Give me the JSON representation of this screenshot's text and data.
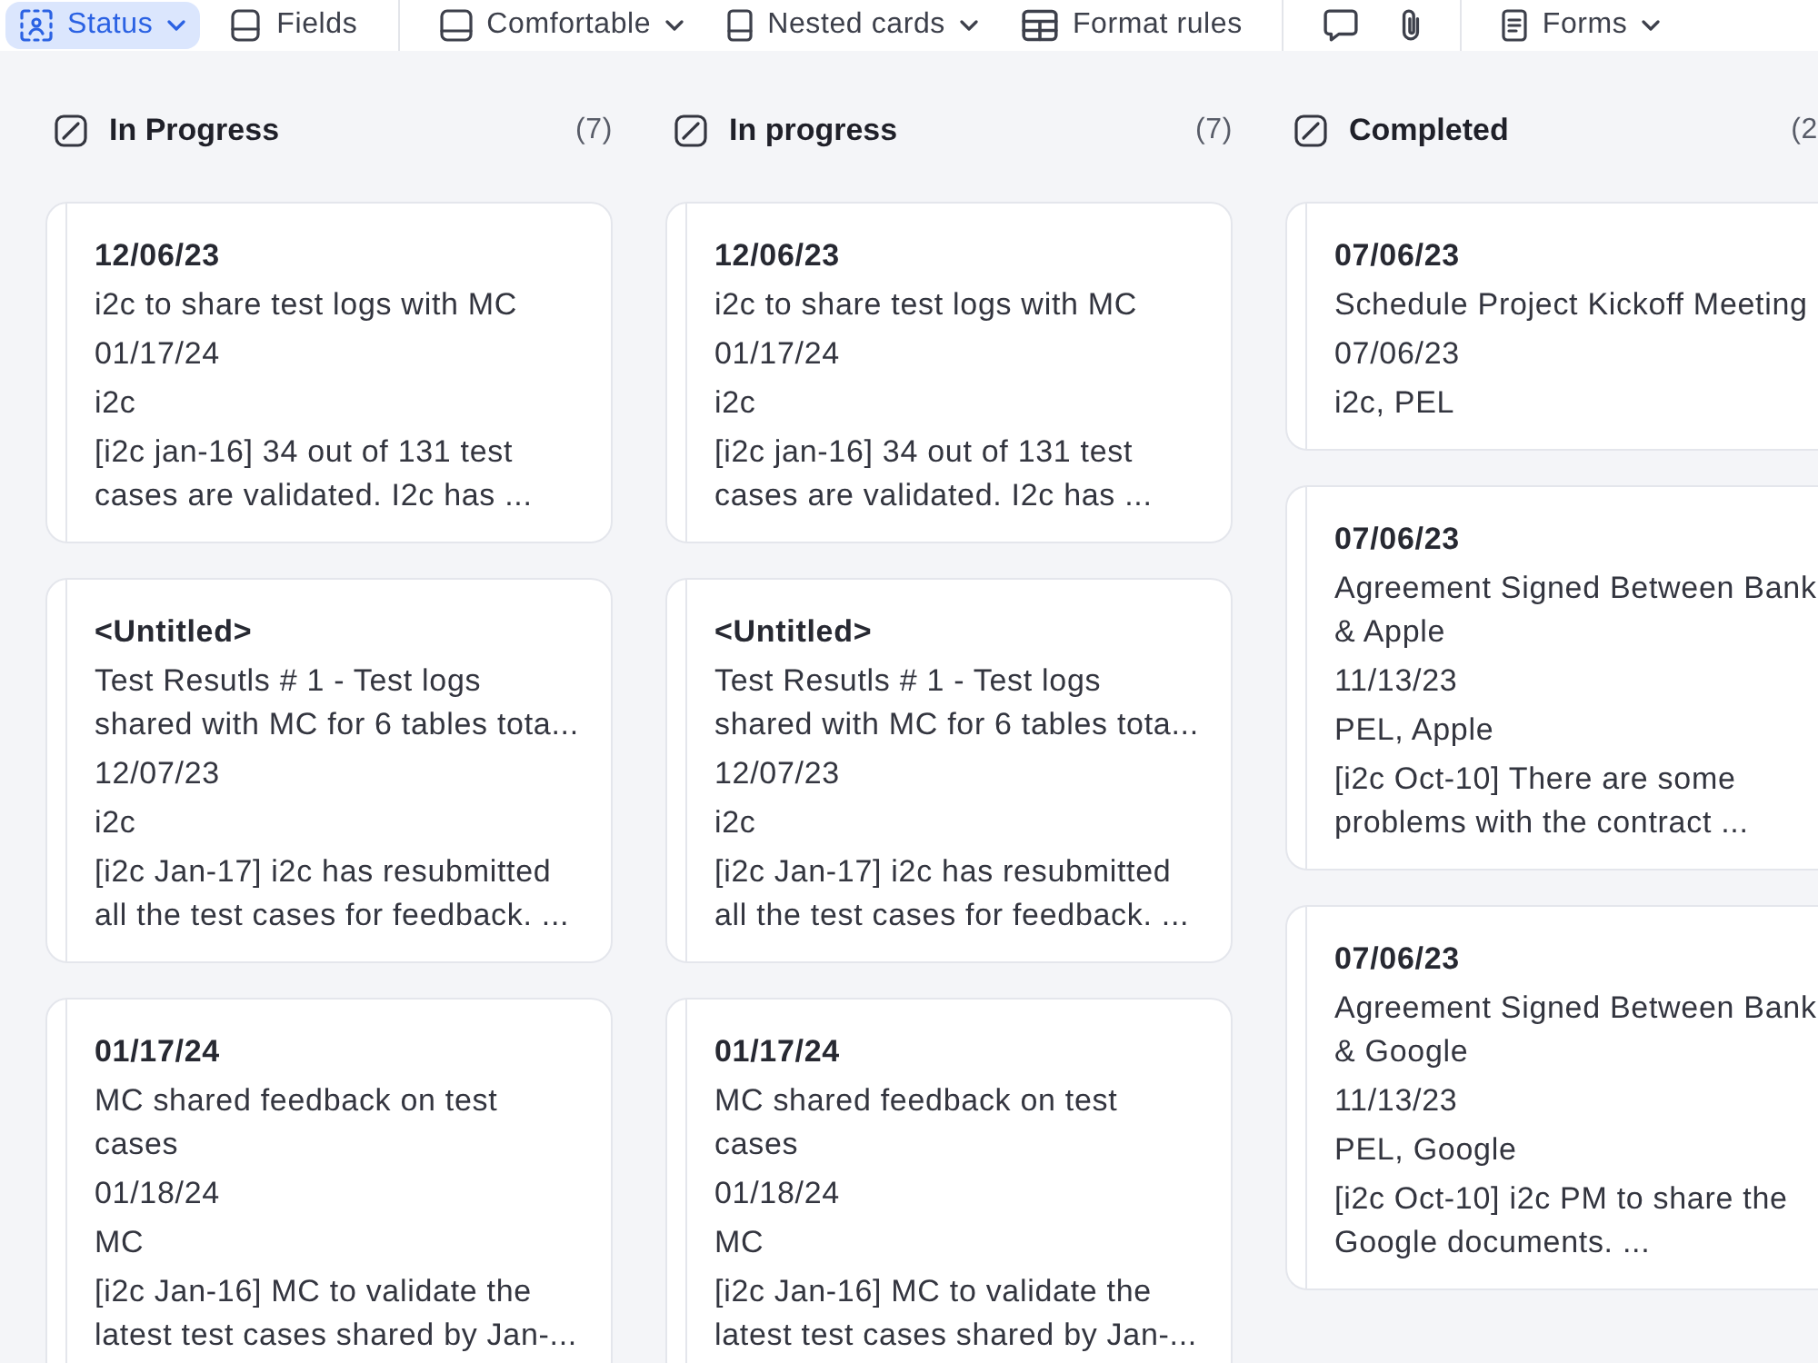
{
  "toolbar": [
    {
      "items": [
        {
          "label": "Status",
          "selected": true,
          "dropdown": true
        },
        {
          "label": "Fields",
          "selected": false,
          "dropdown": false
        }
      ]
    },
    {
      "items": [
        {
          "label": "Comfortable",
          "selected": false,
          "dropdown": true
        },
        {
          "label": "Nested cards",
          "selected": false,
          "dropdown": true
        },
        {
          "label": "Format rules",
          "selected": false,
          "dropdown": false
        }
      ]
    },
    {
      "items": [
        {
          "selected": false,
          "dropdown": false
        },
        {
          "selected": false,
          "dropdown": false
        }
      ]
    },
    {
      "items": [
        {
          "label": "Forms",
          "selected": false,
          "dropdown": true
        }
      ]
    }
  ],
  "columns": [
    {
      "title": "In Progress",
      "count": "(7)",
      "cards": [
        {
          "title": "12/06/23",
          "fields": [
            "i2c to share test logs with MC",
            "01/17/24",
            "i2c",
            "[i2c jan-16] 34 out of 131 test cases are validated. I2c has ..."
          ]
        },
        {
          "title": "<Untitled>",
          "fields": [
            "Test Resutls # 1 - Test logs shared with MC for 6 tables tota...",
            "12/07/23",
            "i2c",
            "[i2c Jan-17] i2c has resubmitted all the test cases for feedback. ..."
          ]
        },
        {
          "title": "01/17/24",
          "fields": [
            "MC shared feedback on test cases",
            "01/18/24",
            "MC",
            "[i2c Jan-16] MC to validate the latest test cases shared by Jan-..."
          ]
        }
      ]
    },
    {
      "title": "In progress",
      "count": "(7)",
      "cards": [
        {
          "title": "12/06/23",
          "fields": [
            "i2c to share test logs with MC",
            "01/17/24",
            "i2c",
            "[i2c jan-16] 34 out of 131 test cases are validated. I2c has ..."
          ]
        },
        {
          "title": "<Untitled>",
          "fields": [
            "Test Resutls # 1 - Test logs shared with MC for 6 tables tota...",
            "12/07/23",
            "i2c",
            "[i2c Jan-17] i2c has resubmitted all the test cases for feedback. ..."
          ]
        },
        {
          "title": "01/17/24",
          "fields": [
            "MC shared feedback on test cases",
            "01/18/24",
            "MC",
            "[i2c Jan-16] MC to validate the latest test cases shared by Jan-..."
          ]
        }
      ]
    },
    {
      "title": "Completed",
      "count": "(2",
      "cards": [
        {
          "title": "07/06/23",
          "fields": [
            "Schedule Project Kickoff Meeting",
            "07/06/23",
            "i2c, PEL"
          ]
        },
        {
          "title": "07/06/23",
          "fields": [
            "Agreement Signed Between Bank & Apple",
            "11/13/23",
            "PEL, Apple",
            "[i2c Oct-10] There are some problems with the contract ..."
          ]
        },
        {
          "title": "07/06/23",
          "fields": [
            "Agreement Signed Between Bank & Google",
            "11/13/23",
            "PEL, Google",
            "[i2c Oct-10] i2c PM to share the Google documents. ..."
          ]
        }
      ]
    }
  ]
}
